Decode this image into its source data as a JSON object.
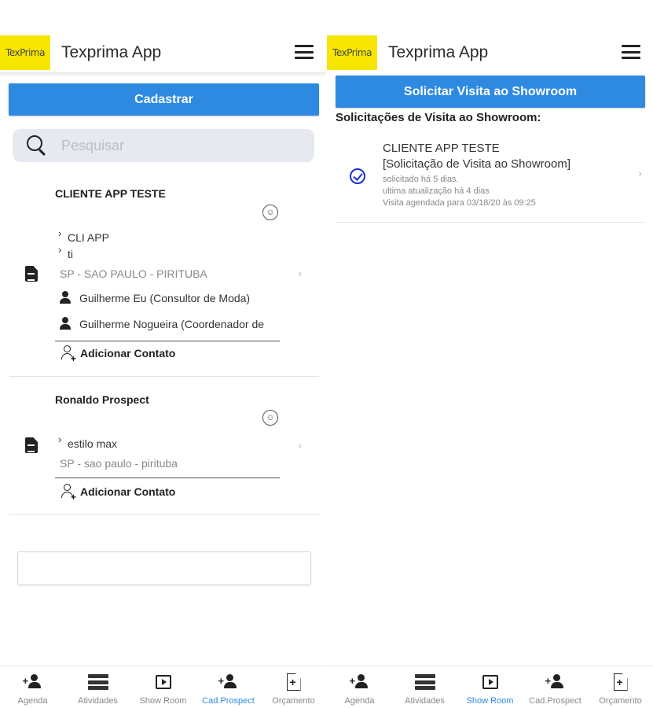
{
  "left": {
    "app": {
      "logo_text": "TexPrima",
      "title": "Texprima App"
    },
    "register_button": "Cadastrar",
    "search": {
      "placeholder": "Pesquisar"
    },
    "clients": [
      {
        "name": "CLIENTE APP TESTE",
        "lines": [
          "CLI APP",
          "ti"
        ],
        "location": "SP - SAO PAULO - PIRITUBA",
        "contacts": [
          "Guilherme Eu (Consultor de Moda)",
          "Guilherme Nogueira (Coordenador de"
        ],
        "add_contact": "Adicionar Contato"
      },
      {
        "name": "Ronaldo Prospect",
        "lines": [
          "estilo max"
        ],
        "location": "SP - sao paulo - pirituba",
        "add_contact": "Adicionar Contato"
      }
    ],
    "nav": {
      "items": [
        "Agenda",
        "Atividades",
        "Show Room",
        "Cad.Prospect",
        "Orçamento"
      ],
      "active": "Cad.Prospect"
    }
  },
  "right": {
    "app": {
      "logo_text": "TexPrima",
      "title": "Texprima App"
    },
    "request_button": "Solicitar Visita ao Showroom",
    "section_title": "Solicitações de Visita ao Showroom:",
    "request": {
      "client": "CLIENTE APP TESTE",
      "subtitle": "[Solicitação de Visita ao Showroom]",
      "requested": "solicitado há 5 dias.",
      "updated": "ultima atualização há 4 dias",
      "scheduled": "Visita agendada para 03/18/20 às 09:25"
    },
    "nav": {
      "items": [
        "Agenda",
        "Atividades",
        "Show Room",
        "Cad.Prospect",
        "Orçamento"
      ],
      "active": "Show Room"
    }
  },
  "colors": {
    "primary": "#2d8ae0",
    "logo_bg": "#f7e600",
    "check": "#1b2fd6"
  }
}
